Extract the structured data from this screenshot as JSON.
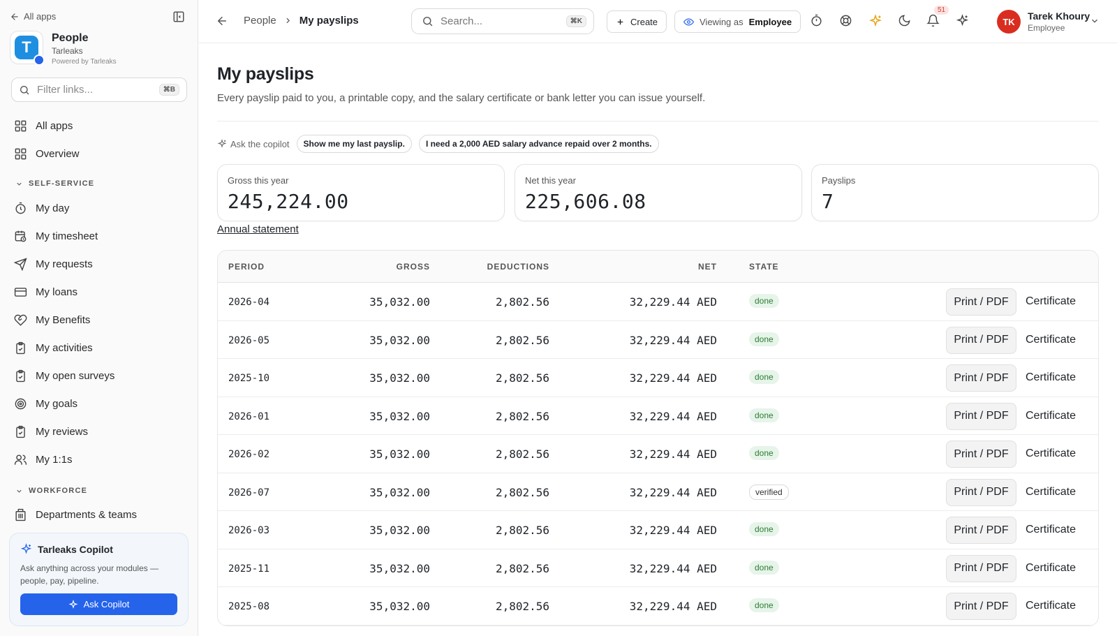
{
  "sidebar": {
    "back_label": "All apps",
    "app_name": "People",
    "org_name": "Tarleaks",
    "powered_by": "Powered by Tarleaks",
    "logo_letter": "T",
    "filter_placeholder": "Filter links...",
    "filter_shortcut": "⌘B",
    "top_items": [
      {
        "label": "All apps",
        "icon": "grid-icon"
      },
      {
        "label": "Overview",
        "icon": "grid-icon"
      }
    ],
    "section_self_service": "SELF-SERVICE",
    "self_service_items": [
      {
        "label": "My day",
        "icon": "timer-icon"
      },
      {
        "label": "My timesheet",
        "icon": "calendar-clock-icon"
      },
      {
        "label": "My requests",
        "icon": "send-icon"
      },
      {
        "label": "My loans",
        "icon": "credit-card-icon"
      },
      {
        "label": "My Benefits",
        "icon": "heart-handshake-icon"
      },
      {
        "label": "My activities",
        "icon": "clipboard-check-icon"
      },
      {
        "label": "My open surveys",
        "icon": "clipboard-check-icon"
      },
      {
        "label": "My goals",
        "icon": "target-icon"
      },
      {
        "label": "My reviews",
        "icon": "clipboard-check-icon"
      },
      {
        "label": "My 1:1s",
        "icon": "users-icon"
      }
    ],
    "section_workforce": "WORKFORCE",
    "workforce_items": [
      {
        "label": "Departments & teams",
        "icon": "building-icon"
      }
    ],
    "copilot": {
      "title": "Tarleaks Copilot",
      "description": "Ask anything across your modules — people, pay, pipeline.",
      "button": "Ask Copilot"
    }
  },
  "topbar": {
    "breadcrumb": [
      "People",
      "My payslips"
    ],
    "search_placeholder": "Search...",
    "search_shortcut": "⌘K",
    "create_label": "Create",
    "viewing_as_label": "Viewing as",
    "viewing_as_value": "Employee",
    "notification_count": "51",
    "user": {
      "initials": "TK",
      "name": "Tarek Khoury",
      "role": "Employee"
    }
  },
  "page": {
    "title": "My payslips",
    "subtitle": "Every payslip paid to you, a printable copy, and the salary certificate or bank letter you can issue yourself.",
    "copilot_label": "Ask the copilot",
    "suggestions": [
      "Show me my last payslip.",
      "I need a 2,000 AED salary advance repaid over 2 months."
    ],
    "stats": [
      {
        "label": "Gross this year",
        "value": "245,224.00"
      },
      {
        "label": "Net this year",
        "value": "225,606.08"
      },
      {
        "label": "Payslips",
        "value": "7"
      }
    ],
    "annual_statement": "Annual statement"
  },
  "table": {
    "columns": [
      "PERIOD",
      "GROSS",
      "DEDUCTIONS",
      "NET",
      "STATE"
    ],
    "print_label": "Print / PDF",
    "certificate_label": "Certificate",
    "rows": [
      {
        "period": "2026-04",
        "gross": "35,032.00",
        "deductions": "2,802.56",
        "net": "32,229.44 AED",
        "state": "done"
      },
      {
        "period": "2026-05",
        "gross": "35,032.00",
        "deductions": "2,802.56",
        "net": "32,229.44 AED",
        "state": "done"
      },
      {
        "period": "2025-10",
        "gross": "35,032.00",
        "deductions": "2,802.56",
        "net": "32,229.44 AED",
        "state": "done"
      },
      {
        "period": "2026-01",
        "gross": "35,032.00",
        "deductions": "2,802.56",
        "net": "32,229.44 AED",
        "state": "done"
      },
      {
        "period": "2026-02",
        "gross": "35,032.00",
        "deductions": "2,802.56",
        "net": "32,229.44 AED",
        "state": "done"
      },
      {
        "period": "2026-07",
        "gross": "35,032.00",
        "deductions": "2,802.56",
        "net": "32,229.44 AED",
        "state": "verified"
      },
      {
        "period": "2026-03",
        "gross": "35,032.00",
        "deductions": "2,802.56",
        "net": "32,229.44 AED",
        "state": "done"
      },
      {
        "period": "2025-11",
        "gross": "35,032.00",
        "deductions": "2,802.56",
        "net": "32,229.44 AED",
        "state": "done"
      },
      {
        "period": "2025-08",
        "gross": "35,032.00",
        "deductions": "2,802.56",
        "net": "32,229.44 AED",
        "state": "done"
      }
    ]
  },
  "colors": {
    "accent": "#2563eb",
    "avatar": "#d92d20",
    "done_bg": "#e6f4ea",
    "done_text": "#2e7d32"
  }
}
